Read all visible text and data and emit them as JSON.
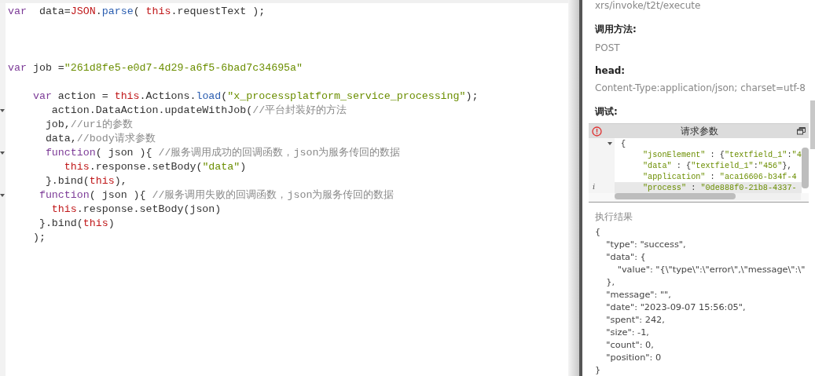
{
  "editor": {
    "lines": [
      {
        "kind": "code",
        "fold_marker": false,
        "tokens": [
          {
            "kind": "kw",
            "s": "var"
          },
          {
            "kind": "plain",
            "s": "  data="
          },
          {
            "kind": "builtin",
            "s": "JSON"
          },
          {
            "kind": "plain",
            "s": "."
          },
          {
            "kind": "fn",
            "s": "parse"
          },
          {
            "kind": "plain",
            "s": "( "
          },
          {
            "kind": "this",
            "s": "this"
          },
          {
            "kind": "plain",
            "s": ".requestText );"
          }
        ]
      },
      {
        "kind": "blank"
      },
      {
        "kind": "blank"
      },
      {
        "kind": "blank"
      },
      {
        "kind": "code",
        "fold_marker": false,
        "tokens": [
          {
            "kind": "kw",
            "s": "var"
          },
          {
            "kind": "plain",
            "s": " job ="
          },
          {
            "kind": "str",
            "s": "\"261d8fe5-e0d7-4d29-a6f5-6bad7c34695a\""
          }
        ]
      },
      {
        "kind": "blank"
      },
      {
        "kind": "code",
        "fold_marker": false,
        "tokens": [
          {
            "kind": "kw",
            "s": "    var"
          },
          {
            "kind": "plain",
            "s": " action = "
          },
          {
            "kind": "this",
            "s": "this"
          },
          {
            "kind": "plain",
            "s": ".Actions."
          },
          {
            "kind": "fn",
            "s": "load"
          },
          {
            "kind": "plain",
            "s": "("
          },
          {
            "kind": "str",
            "s": "\"x_processplatform_service_processing\""
          },
          {
            "kind": "plain",
            "s": ");"
          }
        ]
      },
      {
        "kind": "code",
        "fold_marker": true,
        "tokens": [
          {
            "kind": "plain",
            "s": "       action.DataAction.updateWithJob("
          },
          {
            "kind": "cmt",
            "s": "//平台封装好的方法"
          }
        ]
      },
      {
        "kind": "code",
        "fold_marker": false,
        "tokens": [
          {
            "kind": "plain",
            "s": "      job,"
          },
          {
            "kind": "cmt",
            "s": "//uri的参数"
          }
        ]
      },
      {
        "kind": "code",
        "fold_marker": false,
        "tokens": [
          {
            "kind": "plain",
            "s": "      data,"
          },
          {
            "kind": "cmt",
            "s": "//body请求参数"
          }
        ]
      },
      {
        "kind": "code",
        "fold_marker": true,
        "tokens": [
          {
            "kind": "kw",
            "s": "      function"
          },
          {
            "kind": "plain",
            "s": "( json ){ "
          },
          {
            "kind": "cmt",
            "s": "//服务调用成功的回调函数，json为服务传回的数据"
          }
        ]
      },
      {
        "kind": "code",
        "fold_marker": false,
        "tokens": [
          {
            "kind": "this",
            "s": "         this"
          },
          {
            "kind": "plain",
            "s": ".response.setBody("
          },
          {
            "kind": "str",
            "s": "\"data\""
          },
          {
            "kind": "plain",
            "s": ")"
          }
        ]
      },
      {
        "kind": "code",
        "fold_marker": false,
        "tokens": [
          {
            "kind": "plain",
            "s": "      }.bind("
          },
          {
            "kind": "this",
            "s": "this"
          },
          {
            "kind": "plain",
            "s": "),"
          }
        ]
      },
      {
        "kind": "code",
        "fold_marker": true,
        "tokens": [
          {
            "kind": "kw",
            "s": "     function"
          },
          {
            "kind": "plain",
            "s": "( json ){ "
          },
          {
            "kind": "cmt",
            "s": "//服务调用失败的回调函数，json为服务传回的数据"
          }
        ]
      },
      {
        "kind": "code",
        "fold_marker": false,
        "tokens": [
          {
            "kind": "this",
            "s": "       this"
          },
          {
            "kind": "plain",
            "s": ".response.setBody(json)"
          }
        ]
      },
      {
        "kind": "code",
        "fold_marker": false,
        "tokens": [
          {
            "kind": "plain",
            "s": "     }.bind("
          },
          {
            "kind": "this",
            "s": "this"
          },
          {
            "kind": "plain",
            "s": ")"
          }
        ]
      },
      {
        "kind": "code",
        "fold_marker": false,
        "tokens": [
          {
            "kind": "plain",
            "s": "    );"
          }
        ]
      }
    ]
  },
  "side_panel": {
    "url": "xrs/invoke/t2t/execute",
    "sections": [
      {
        "label": "调用方法:",
        "value": "POST"
      },
      {
        "label": "head:",
        "value": "Content-Type:application/json; charset=utf-8"
      }
    ],
    "debug_label": "调试:",
    "request_editor": {
      "title": "请求参数",
      "lines": [
        {
          "fold_marker": true,
          "active": false,
          "tokens": [
            {
              "kind": "plain",
              "s": "{"
            }
          ]
        },
        {
          "fold_marker": false,
          "active": false,
          "tokens": [
            {
              "kind": "str",
              "s": "\"jsonElement\""
            },
            {
              "kind": "plain",
              "s": " : {"
            },
            {
              "kind": "str",
              "s": "\"textfield_1\""
            },
            {
              "kind": "plain",
              "s": ":"
            },
            {
              "kind": "str",
              "s": "\"4"
            }
          ]
        },
        {
          "fold_marker": false,
          "active": false,
          "tokens": [
            {
              "kind": "str",
              "s": "\"data\""
            },
            {
              "kind": "plain",
              "s": " : {"
            },
            {
              "kind": "str",
              "s": "\"textfield_1\""
            },
            {
              "kind": "plain",
              "s": ":"
            },
            {
              "kind": "str",
              "s": "\"456\""
            },
            {
              "kind": "plain",
              "s": "},"
            }
          ]
        },
        {
          "fold_marker": false,
          "active": false,
          "tokens": [
            {
              "kind": "str",
              "s": "\"application\""
            },
            {
              "kind": "plain",
              "s": " : "
            },
            {
              "kind": "str",
              "s": "\"aca16606-b34f-4"
            }
          ]
        },
        {
          "fold_marker": false,
          "active": true,
          "gutter_mark": "i",
          "tokens": [
            {
              "kind": "str",
              "s": "\"process\""
            },
            {
              "kind": "plain",
              "s": " : "
            },
            {
              "kind": "str",
              "s": "\"0de888f0-21b8-4337-"
            }
          ]
        }
      ]
    },
    "result": {
      "label": "执行结果",
      "lines": [
        "{",
        "    \"type\": \"success\",",
        "    \"data\": {",
        "        \"value\": \"{\\\"type\\\":\\\"error\\\",\\\"message\\\":\\\"",
        "    },",
        "    \"message\": \"\",",
        "    \"date\": \"2023-09-07 15:56:05\",",
        "    \"spent\": 242,",
        "    \"size\": -1,",
        "    \"count\": 0,",
        "    \"position\": 0",
        "}"
      ]
    }
  }
}
